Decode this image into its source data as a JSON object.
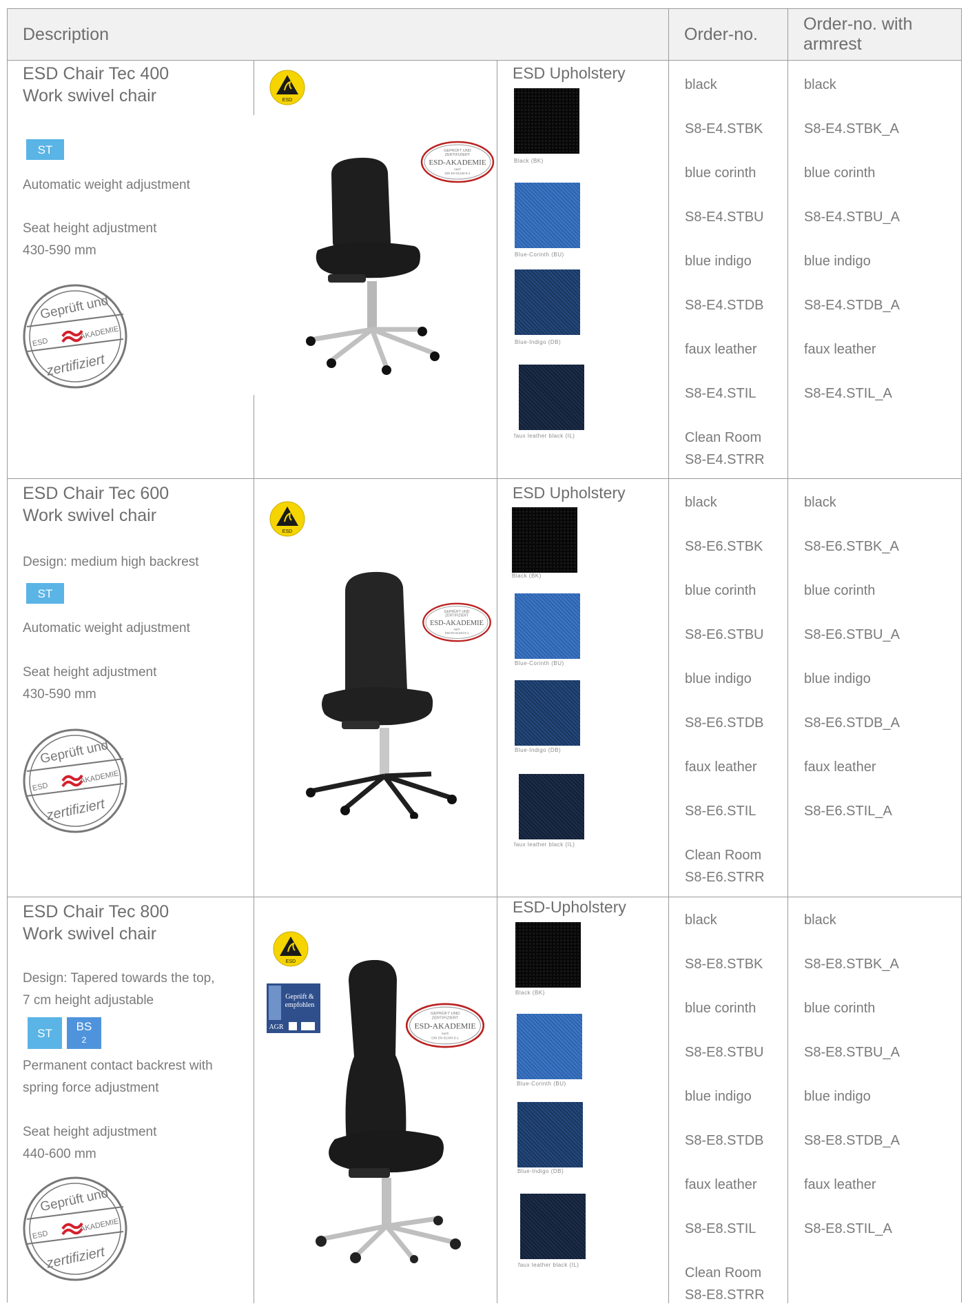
{
  "header": {
    "description": "Description",
    "order_no": "Order-no.",
    "order_no_armrest": "Order-no. with armrest"
  },
  "products": [
    {
      "title1": "ESD Chair Tec 400",
      "title2": "Work swivel chair",
      "design": "",
      "badges": [
        "ST"
      ],
      "feature1": "Automatic weight adjustment",
      "feature2a": "Seat height adjustment",
      "feature2b": "430-590 mm",
      "upholstery_heading": "ESD Upholstery",
      "swatch_captions": [
        "Black (BK)",
        "Blue-Corinth (BU)",
        "Blue-Indigo (DB)",
        "faux leather black (IL)"
      ],
      "order_col": [
        "black",
        "S8-E4.STBK",
        "blue corinth",
        "S8-E4.STBU",
        "blue indigo",
        "S8-E4.STDB",
        "faux leather",
        "S8-E4.STIL",
        "Clean Room",
        "S8-E4.STRR"
      ],
      "armrest_col": [
        "black",
        "S8-E4.STBK_A",
        "blue corinth",
        "S8-E4.STBU_A",
        "blue indigo",
        "S8-E4.STDB_A",
        "faux leather",
        "S8-E4.STIL_A"
      ]
    },
    {
      "title1": "ESD Chair Tec 600",
      "title2": "Work swivel chair",
      "design": "Design: medium high backrest",
      "badges": [
        "ST"
      ],
      "feature1": "Automatic weight adjustment",
      "feature2a": "Seat height adjustment",
      "feature2b": "430-590 mm",
      "upholstery_heading": "ESD Upholstery",
      "swatch_captions": [
        "Black (BK)",
        "Blue-Corinth (BU)",
        "Blue-Indigo (DB)",
        "faux leather black (IL)"
      ],
      "order_col": [
        "black",
        "S8-E6.STBK",
        "blue corinth",
        "S8-E6.STBU",
        "blue indigo",
        "S8-E6.STDB",
        "faux leather",
        "S8-E6.STIL",
        "Clean Room",
        "S8-E6.STRR"
      ],
      "armrest_col": [
        "black",
        "S8-E6.STBK_A",
        "blue corinth",
        "S8-E6.STBU_A",
        "blue indigo",
        "S8-E6.STDB_A",
        "faux leather",
        "S8-E6.STIL_A"
      ]
    },
    {
      "title1": "ESD Chair Tec 800",
      "title2": "Work swivel chair",
      "design": "Design: Tapered towards the top,",
      "design2": "7 cm height adjustable",
      "badges": [
        "ST",
        "BS",
        "2"
      ],
      "feature1": "Permanent contact backrest with",
      "feature1b": "spring force adjustment",
      "feature2a": "Seat height adjustment",
      "feature2b": "440-600 mm",
      "upholstery_heading": "ESD-Upholstery",
      "swatch_captions": [
        "Black (BK)",
        "Blue-Corinth (BU)",
        "Blue-Indigo (DB)",
        "faux leather black (IL)"
      ],
      "order_col": [
        "black",
        "S8-E8.STBK",
        "blue corinth",
        "S8-E8.STBU",
        "blue indigo",
        "S8-E8.STDB",
        "faux leather",
        "S8-E8.STIL",
        "Clean Room",
        "S8-E8.STRR"
      ],
      "armrest_col": [
        "black",
        "S8-E8.STBK_A",
        "blue corinth",
        "S8-E8.STBU_A",
        "blue indigo",
        "S8-E8.STDB_A",
        "faux leather",
        "S8-E8.STIL_A"
      ]
    }
  ],
  "stamp": {
    "top": "Geprüft und",
    "middle": "AKADEMIE",
    "left": "ESD",
    "bottom": "zertifiziert"
  },
  "esd_symbol_label": "ESD",
  "cert_logo": {
    "line1": "GEPRÜFT UND",
    "line2": "ZERTIFIZIERT",
    "main": "ESD-AKADEMIE",
    "line3": "nach",
    "line4": "DIN EN 61340-5-1"
  },
  "agr_logo": {
    "line1": "Geprüft &",
    "line2": "empfohlen",
    "brand": "AGR"
  },
  "colors": {
    "badge_st": "#5ab4e6",
    "badge_bs": "#4f93dd",
    "grid": "#9a9a9a",
    "header_bg": "#f1f1f1",
    "esd_yellow": "#f5d400"
  }
}
